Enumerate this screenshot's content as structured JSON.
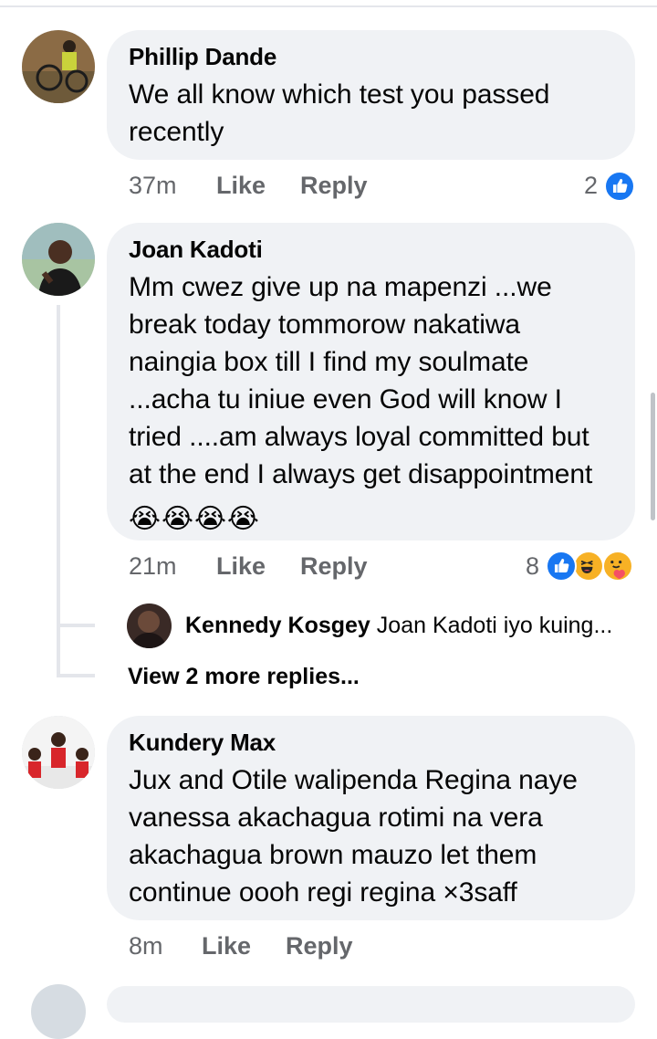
{
  "comments": [
    {
      "author": "Phillip Dande",
      "text": "We all know which test you passed recently",
      "time": "37m",
      "like_label": "Like",
      "reply_label": "Reply",
      "reaction_count": "2",
      "reactions": [
        "like-icon"
      ]
    },
    {
      "author": "Joan Kadoti",
      "text": "Mm cwez give up na mapenzi ...we break today tommorow nakatiwa naingia box till I find my soulmate ...acha tu iniue even God will know I tried ....am always loyal committed but at the end I always get disappointment",
      "emoji": [
        "😭",
        "😭",
        "😭",
        "😭"
      ],
      "time": "21m",
      "like_label": "Like",
      "reply_label": "Reply",
      "reaction_count": "8",
      "reactions": [
        "like-icon",
        "haha-icon",
        "care-icon"
      ],
      "reply_preview": {
        "author": "Kennedy Kosgey",
        "text": "Joan Kadoti iyo kuing..."
      },
      "more_replies_label": "View 2 more replies..."
    },
    {
      "author": "Kundery Max",
      "text": "Jux and Otile walipenda Regina naye vanessa akachagua rotimi na vera akachagua brown mauzo let them continue oooh regi regina ×3saff",
      "time": "8m",
      "like_label": "Like",
      "reply_label": "Reply"
    }
  ],
  "colors": {
    "bubble": "#f0f2f5",
    "meta_text": "#65676b",
    "like_blue": "#1877f2",
    "haha_yellow": "#f7b125"
  }
}
